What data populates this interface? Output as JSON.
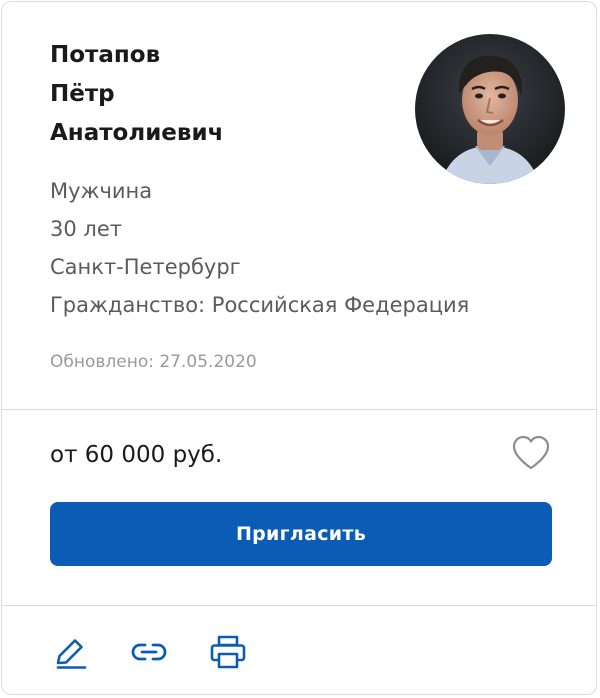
{
  "candidate": {
    "last_name": "Потапов",
    "first_name": "Пётр",
    "patronymic": "Анатолиевич",
    "gender": "Мужчина",
    "age": "30 лет",
    "city": "Санкт-Петербург",
    "citizenship": "Гражданство: Российская Федерация",
    "updated": "Обновлено: 27.05.2020"
  },
  "salary": "от 60 000 руб.",
  "buttons": {
    "invite": "Пригласить"
  },
  "icons": {
    "favorite": "heart-outline-icon",
    "edit": "pencil-icon",
    "link": "link-icon",
    "print": "printer-icon"
  },
  "colors": {
    "accent": "#0b5cb5",
    "icon": "#0b5cb5",
    "text_primary": "#1a1a1a",
    "text_secondary": "#5b5b5b",
    "text_muted": "#9a9a9a",
    "divider": "#dcdcdc"
  }
}
